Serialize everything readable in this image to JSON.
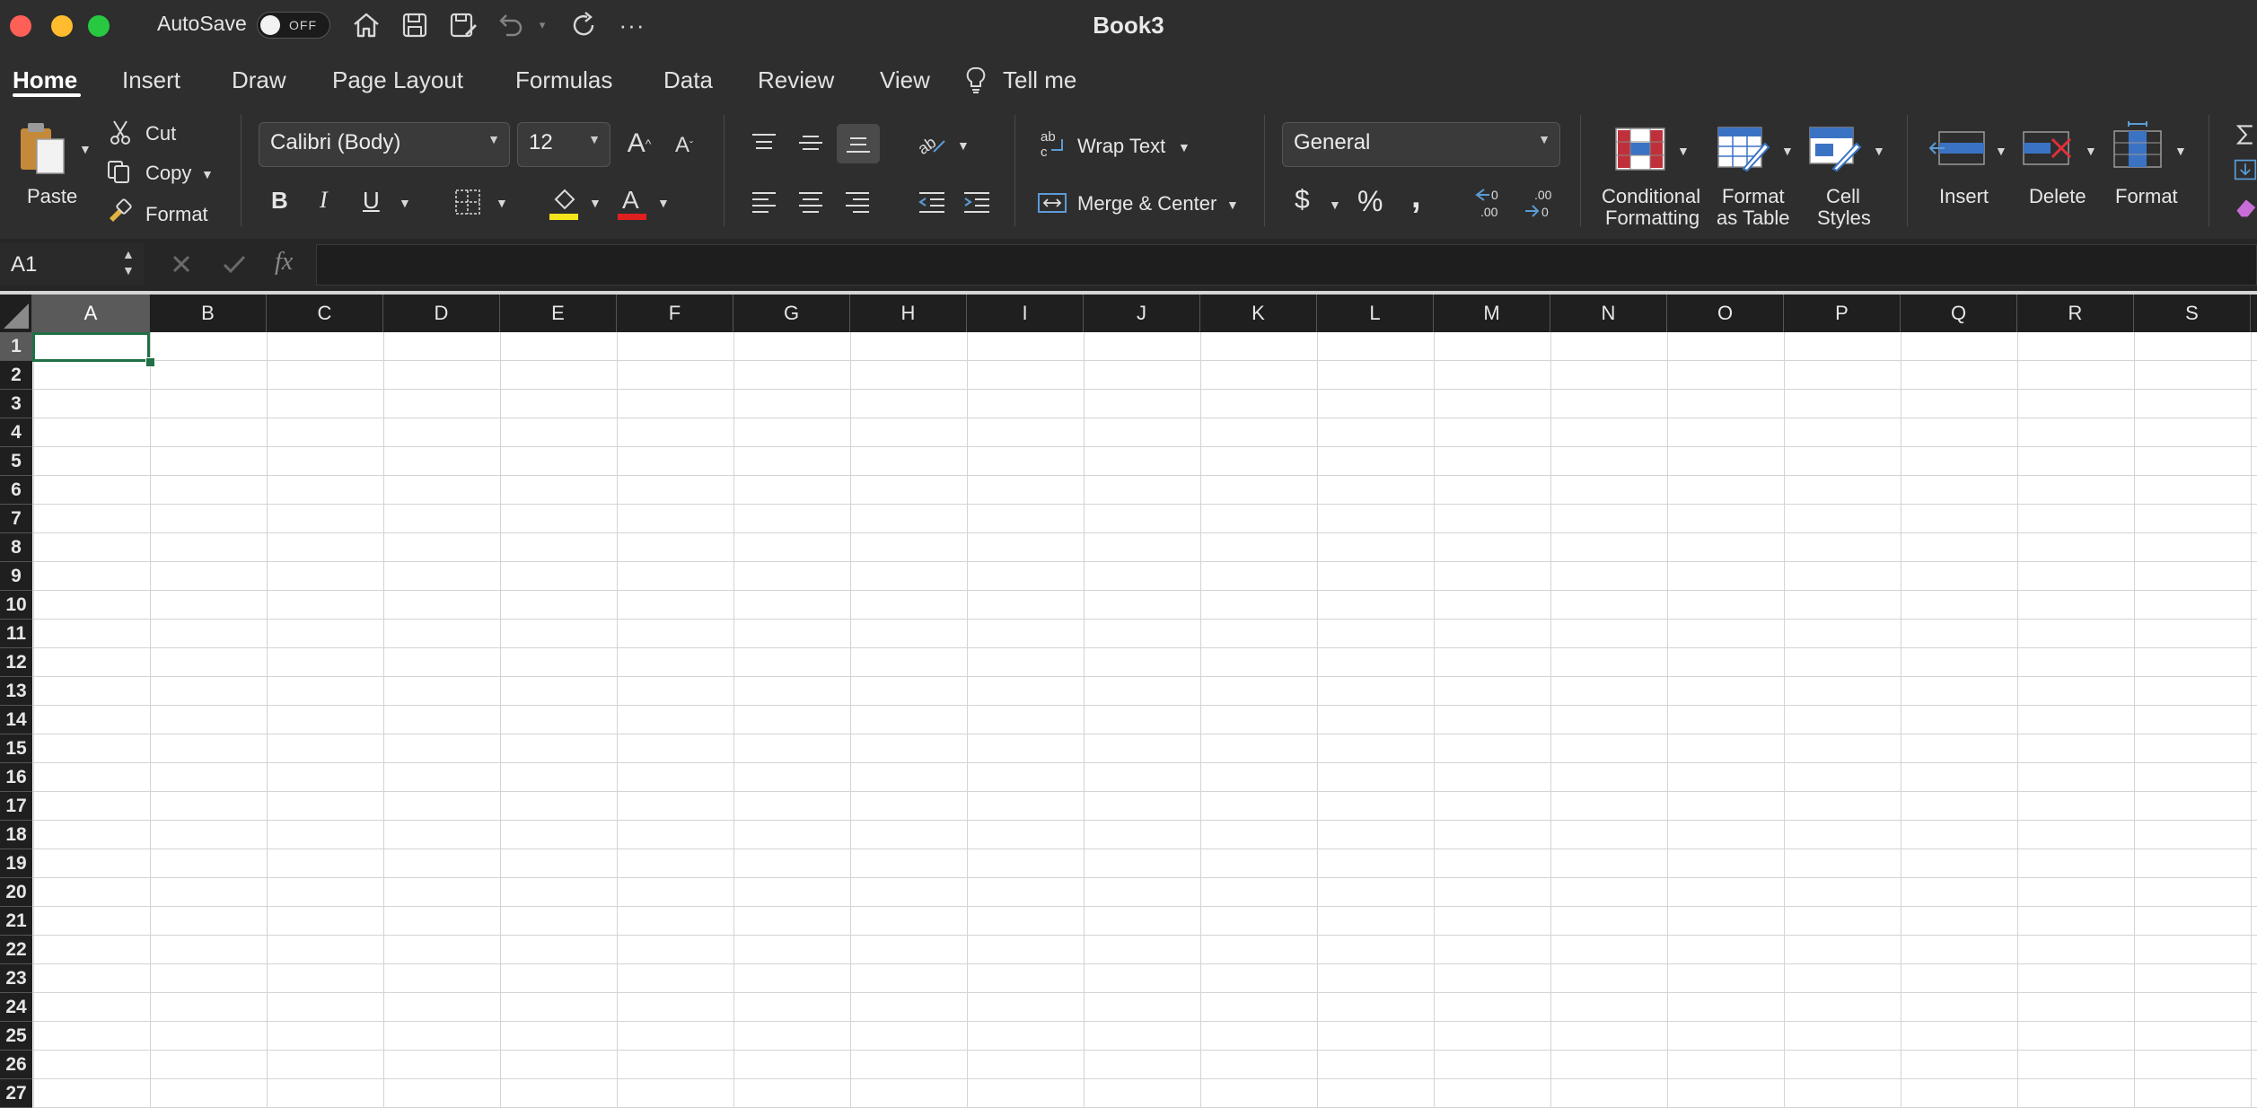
{
  "window": {
    "title": "Book3",
    "traffic_lights": [
      {
        "name": "close",
        "color": "#fe5f57"
      },
      {
        "name": "minimize",
        "color": "#febc2e"
      },
      {
        "name": "zoom",
        "color": "#28c840"
      }
    ]
  },
  "quick_access": {
    "autosave_label": "AutoSave",
    "autosave_state": "OFF",
    "icons": [
      "home-icon",
      "save-icon",
      "save-as-icon",
      "undo-icon",
      "redo-icon",
      "more-icon"
    ]
  },
  "tabs": [
    "Home",
    "Insert",
    "Draw",
    "Page Layout",
    "Formulas",
    "Data",
    "Review",
    "View"
  ],
  "active_tab": "Home",
  "tell_me": "Tell me",
  "clipboard": {
    "paste": "Paste",
    "cut": "Cut",
    "copy": "Copy",
    "format": "Format"
  },
  "font": {
    "name": "Calibri (Body)",
    "size": "12",
    "bold": "B",
    "italic": "I",
    "underline": "U",
    "highlight_color": "#f5e41c",
    "font_color": "#e02020"
  },
  "alignment": {
    "wrap_text": "Wrap Text",
    "merge_center": "Merge & Center"
  },
  "number": {
    "format": "General",
    "currency": "$",
    "percent": "%",
    "comma": ","
  },
  "styles": {
    "conditional": [
      "Conditional",
      "Formatting"
    ],
    "format_table": [
      "Format",
      "as Table"
    ],
    "cell_styles": [
      "Cell",
      "Styles"
    ]
  },
  "cells_group": {
    "insert": "Insert",
    "delete": "Delete",
    "format": "Format"
  },
  "formula_bar": {
    "name_box": "A1",
    "fx": "fx",
    "content": ""
  },
  "grid": {
    "columns": [
      "A",
      "B",
      "C",
      "D",
      "E",
      "F",
      "G",
      "H",
      "I",
      "J",
      "K",
      "L",
      "M",
      "N",
      "O",
      "P",
      "Q",
      "R",
      "S"
    ],
    "rows": [
      "1",
      "2",
      "3",
      "4",
      "5",
      "6",
      "7",
      "8",
      "9",
      "10",
      "11",
      "12",
      "13",
      "14",
      "15",
      "16",
      "17",
      "18",
      "19",
      "20",
      "21",
      "22",
      "23",
      "24",
      "25",
      "26",
      "27"
    ],
    "selected_cell": "A1",
    "selection_color": "#1f7145"
  }
}
